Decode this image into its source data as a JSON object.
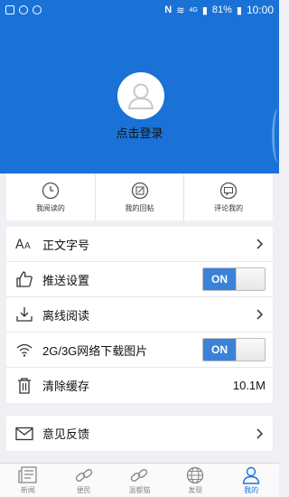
{
  "status_bar": {
    "battery": "81%",
    "time": "10:00",
    "network": "4G"
  },
  "profile": {
    "login_label": "点击登录"
  },
  "quick_links": [
    {
      "label": "我阅读的",
      "icon": "clock-icon"
    },
    {
      "label": "我的回帖",
      "icon": "edit-icon"
    },
    {
      "label": "评论我的",
      "icon": "comment-icon"
    }
  ],
  "settings": [
    {
      "label": "正文字号",
      "icon": "font-size-icon",
      "control": "chevron"
    },
    {
      "label": "推送设置",
      "icon": "thumbs-up-icon",
      "control": "toggle",
      "value": "ON"
    },
    {
      "label": "离线阅读",
      "icon": "download-icon",
      "control": "chevron"
    },
    {
      "label": "2G/3G网络下载图片",
      "icon": "wifi-icon",
      "control": "toggle",
      "value": "ON"
    },
    {
      "label": "清除缓存",
      "icon": "trash-icon",
      "control": "value",
      "value": "10.1M"
    }
  ],
  "feedback": {
    "label": "意见反馈",
    "icon": "mail-icon"
  },
  "nav": [
    {
      "label": "新闻",
      "icon": "newspaper-icon",
      "active": false
    },
    {
      "label": "便民",
      "icon": "link-icon",
      "active": false
    },
    {
      "label": "温都猫",
      "icon": "link-icon",
      "active": false
    },
    {
      "label": "发现",
      "icon": "globe-icon",
      "active": false
    },
    {
      "label": "我的",
      "icon": "person-icon",
      "active": true
    }
  ],
  "colors": {
    "brand": "#1a72d6",
    "toggle_on": "#3a82d8"
  }
}
